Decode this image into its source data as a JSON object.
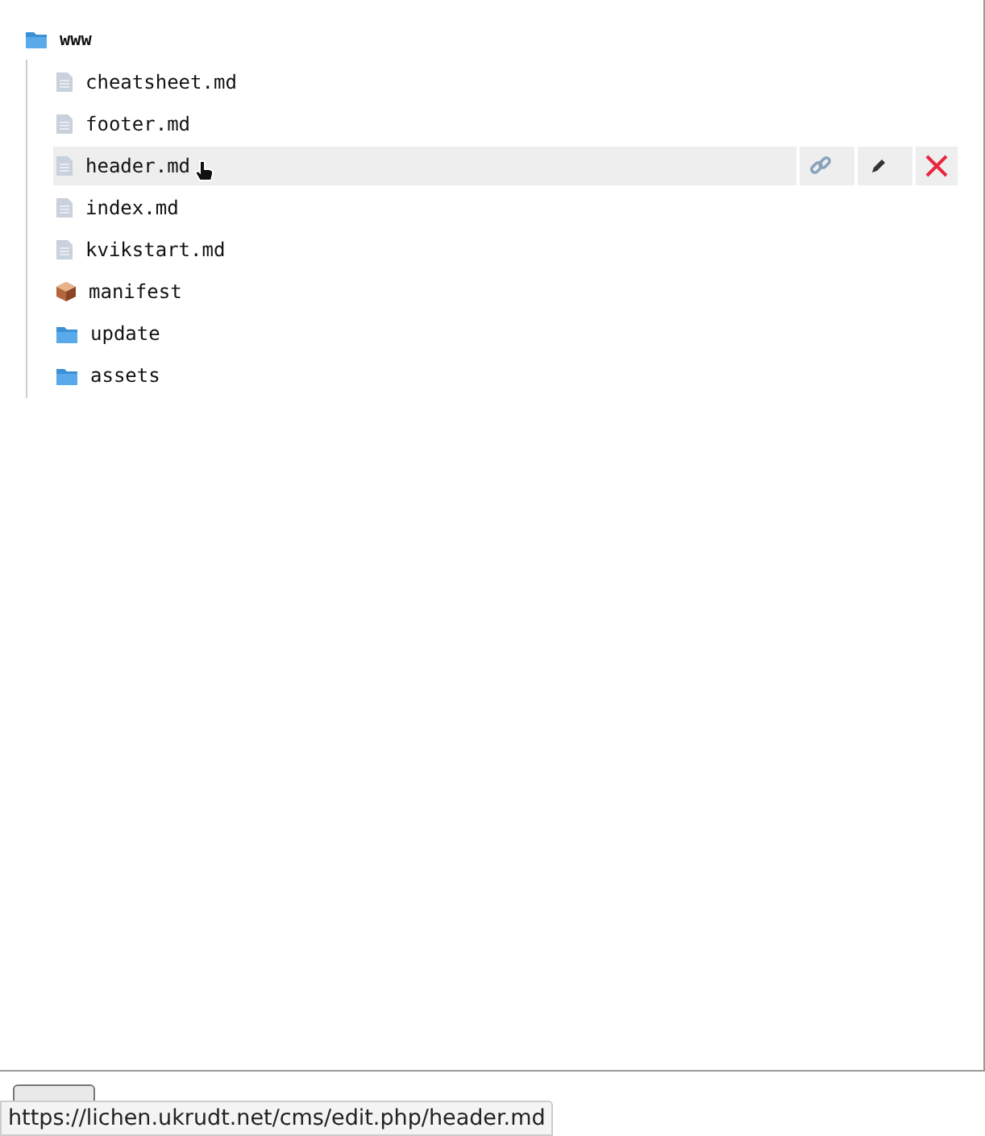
{
  "tree": {
    "root": {
      "label": "www",
      "kind": "folder"
    },
    "children": [
      {
        "label": "cheatsheet.md",
        "kind": "file",
        "hovered": false
      },
      {
        "label": "footer.md",
        "kind": "file",
        "hovered": false
      },
      {
        "label": "header.md",
        "kind": "file",
        "hovered": true
      },
      {
        "label": "index.md",
        "kind": "file",
        "hovered": false
      },
      {
        "label": "kvikstart.md",
        "kind": "file",
        "hovered": false
      },
      {
        "label": "manifest",
        "kind": "package",
        "hovered": false
      },
      {
        "label": "update",
        "kind": "folder",
        "hovered": false
      },
      {
        "label": "assets",
        "kind": "folder",
        "hovered": false
      }
    ]
  },
  "status_url": "https://lichen.ukrudt.net/cms/edit.php/header.md"
}
